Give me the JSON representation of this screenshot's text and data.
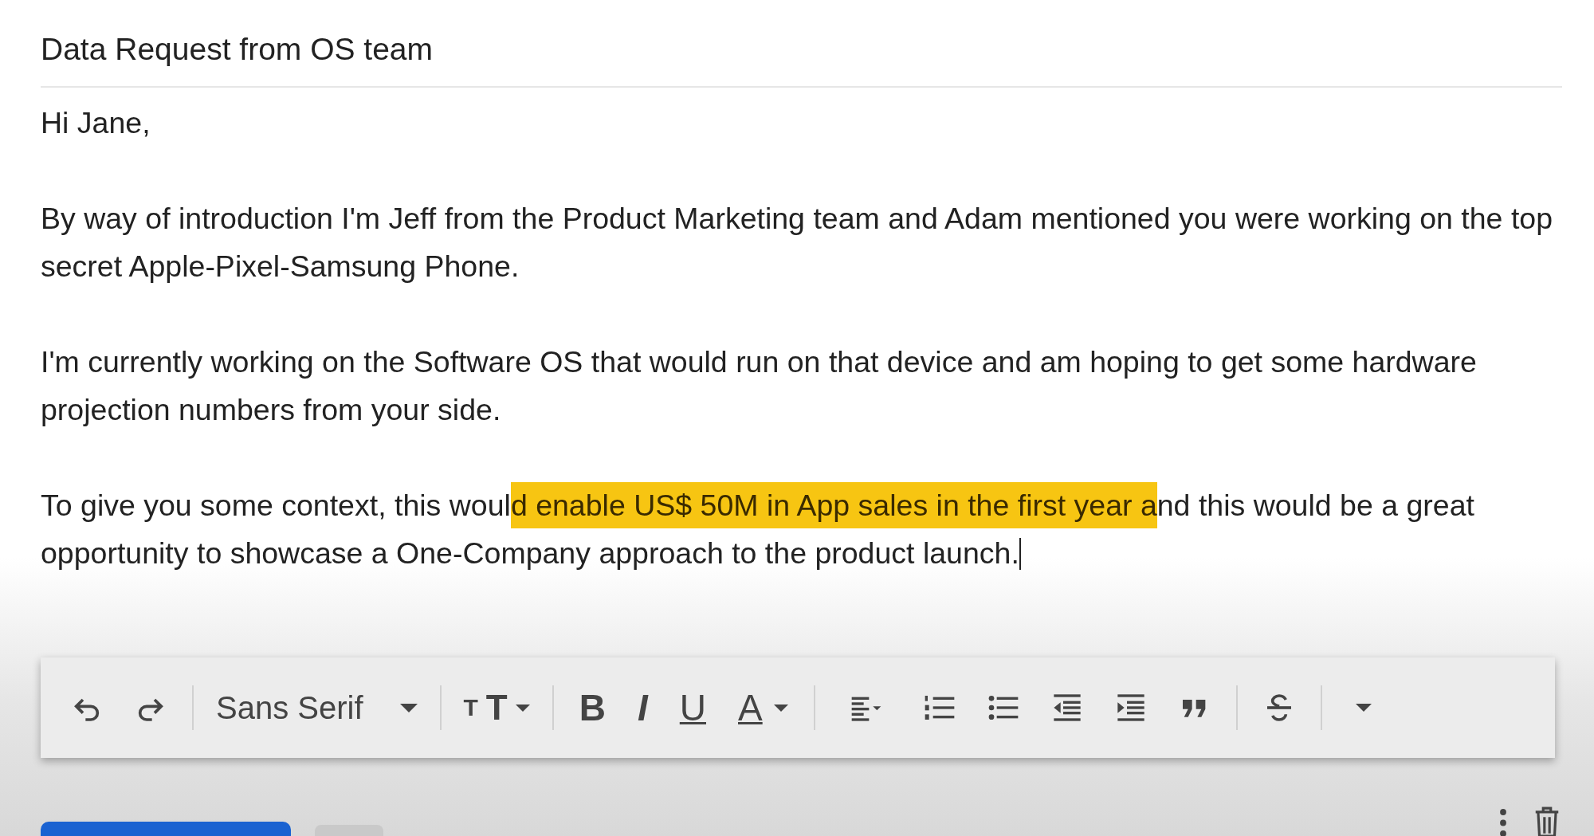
{
  "subject": "Data Request from OS team",
  "body": {
    "caret_at_end": true,
    "paragraphs": [
      [
        {
          "text": "Hi Jane,",
          "highlighted": false
        }
      ],
      [
        {
          "text": "By way of introduction I'm Jeff from the Product Marketing team and Adam mentioned you were working on the top secret Apple-Pixel-Samsung Phone.",
          "highlighted": false
        }
      ],
      [
        {
          "text": "I'm currently working on the Software OS that would run on that device and am hoping to get some hardware projection numbers from your side.",
          "highlighted": false
        }
      ],
      [
        {
          "text": "To give you some context, this woul",
          "highlighted": false
        },
        {
          "text": "d enable US$ 50M in App sales in the first year a",
          "highlighted": true
        },
        {
          "text": "nd this would be a great opportunity to showcase a One-Company approach to the product launch.",
          "highlighted": false
        }
      ]
    ]
  },
  "toolbar": [
    {
      "kind": "undo"
    },
    {
      "kind": "redo"
    },
    {
      "kind": "separator"
    },
    {
      "kind": "font",
      "label": "Sans Serif"
    },
    {
      "kind": "separator"
    },
    {
      "kind": "size",
      "label": "TT"
    },
    {
      "kind": "separator"
    },
    {
      "kind": "bold",
      "label": "B"
    },
    {
      "kind": "italic",
      "label": "I"
    },
    {
      "kind": "underline",
      "label": "U"
    },
    {
      "kind": "color",
      "label": "A"
    },
    {
      "kind": "separator"
    },
    {
      "kind": "align"
    },
    {
      "kind": "numbered"
    },
    {
      "kind": "bulleted"
    },
    {
      "kind": "outdent"
    },
    {
      "kind": "indent"
    },
    {
      "kind": "quote"
    },
    {
      "kind": "separator"
    },
    {
      "kind": "strike"
    },
    {
      "kind": "separator"
    },
    {
      "kind": "more"
    }
  ]
}
